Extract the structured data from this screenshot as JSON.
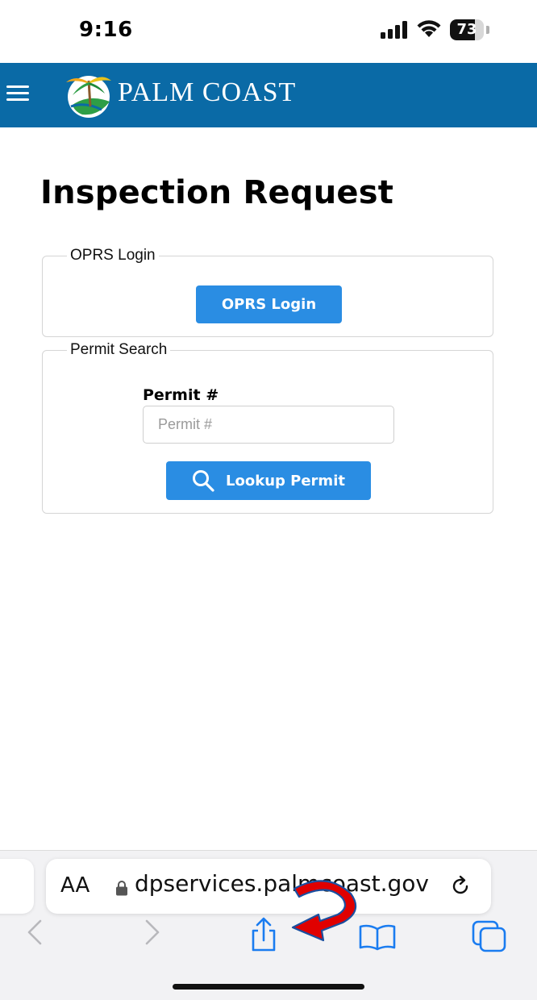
{
  "status_bar": {
    "time": "9:16",
    "battery_level": "73",
    "battery_fraction": 0.73,
    "icons": [
      "signal-icon",
      "wifi-icon",
      "battery-icon"
    ]
  },
  "header": {
    "menu_icon": "hamburger-menu-icon",
    "logo_text": "PALM COAST",
    "brand_color": "#0a6aa6"
  },
  "page": {
    "title": "Inspection Request"
  },
  "oprs_section": {
    "legend": "OPRS Login",
    "button_label": "OPRS Login"
  },
  "permit_section": {
    "legend": "Permit Search",
    "field_label": "Permit #",
    "input_value": "",
    "input_placeholder": "Permit #",
    "button_label": "Lookup Permit",
    "button_icon": "search-icon"
  },
  "browser": {
    "aa_label": "AA",
    "url": "dpservices.palmcoast.gov",
    "toolbar_icons": [
      "back-icon",
      "forward-icon",
      "share-icon",
      "bookmarks-icon",
      "tabs-icon"
    ]
  },
  "colors": {
    "button": "#2a8de3",
    "header_bg": "#0a6aa6",
    "annotation_arrow": "#e00000"
  }
}
